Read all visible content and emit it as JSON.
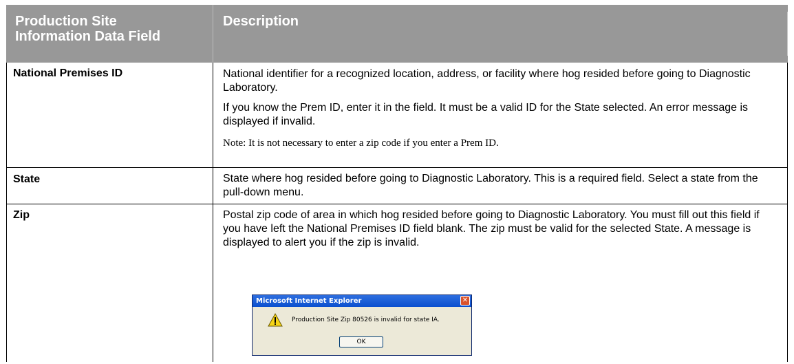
{
  "table": {
    "headers": [
      "Production Site Information Data Field",
      "Description"
    ],
    "rows": [
      {
        "field": "National Premises ID",
        "paragraphs": [
          "National identifier for a recognized location, address, or facility where hog resided before going to Diagnostic Laboratory.",
          "If you know the Prem ID, enter it in the field. It must be a valid ID for the State selected. An error message is displayed if invalid.",
          "Note: It is not necessary to enter a zip code if you enter a Prem ID."
        ]
      },
      {
        "field": "State",
        "paragraphs": [
          "State where hog resided before going to Diagnostic Laboratory. This is a required field. Select a state from the pull-down menu."
        ]
      },
      {
        "field": "Zip",
        "paragraphs": [
          "Postal zip code of area in which hog resided before going to Diagnostic Laboratory. You must fill out this field if you have left the National Premises ID field blank. The zip must be valid for the selected State. A message is displayed to alert you if the zip is invalid."
        ]
      }
    ]
  },
  "dialog": {
    "title": "Microsoft Internet Explorer",
    "message": "Production Site Zip 80526 is invalid for state IA.",
    "ok_label": "OK",
    "close_glyph": "✕",
    "icon": "warning-icon"
  },
  "colors": {
    "header_bg": "#989898",
    "header_text": "#ffffff",
    "dialog_title_bg": "#0a4fcf"
  }
}
